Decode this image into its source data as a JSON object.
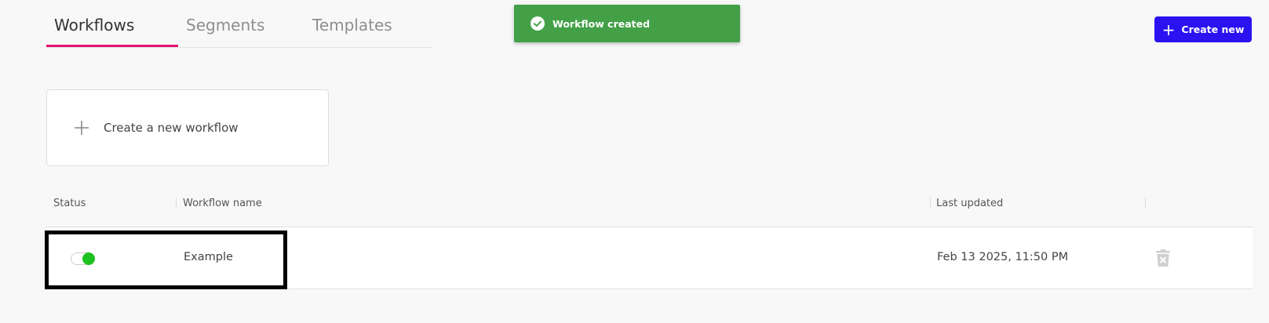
{
  "tabs": [
    {
      "label": "Workflows"
    },
    {
      "label": "Segments"
    },
    {
      "label": "Templates"
    }
  ],
  "toast": {
    "message": "Workflow created",
    "icon": "check-circle-icon",
    "color": "#43a047"
  },
  "header": {
    "create_new_label": "Create new",
    "accent": "#2b12f0"
  },
  "new_workflow_card": {
    "label": "Create a new workflow"
  },
  "table": {
    "columns": [
      "Status",
      "Workflow name",
      "Last updated"
    ],
    "rows": [
      {
        "status_enabled": true,
        "name": "Example",
        "last_updated": "Feb 13 2025, 11:50 PM"
      }
    ]
  }
}
